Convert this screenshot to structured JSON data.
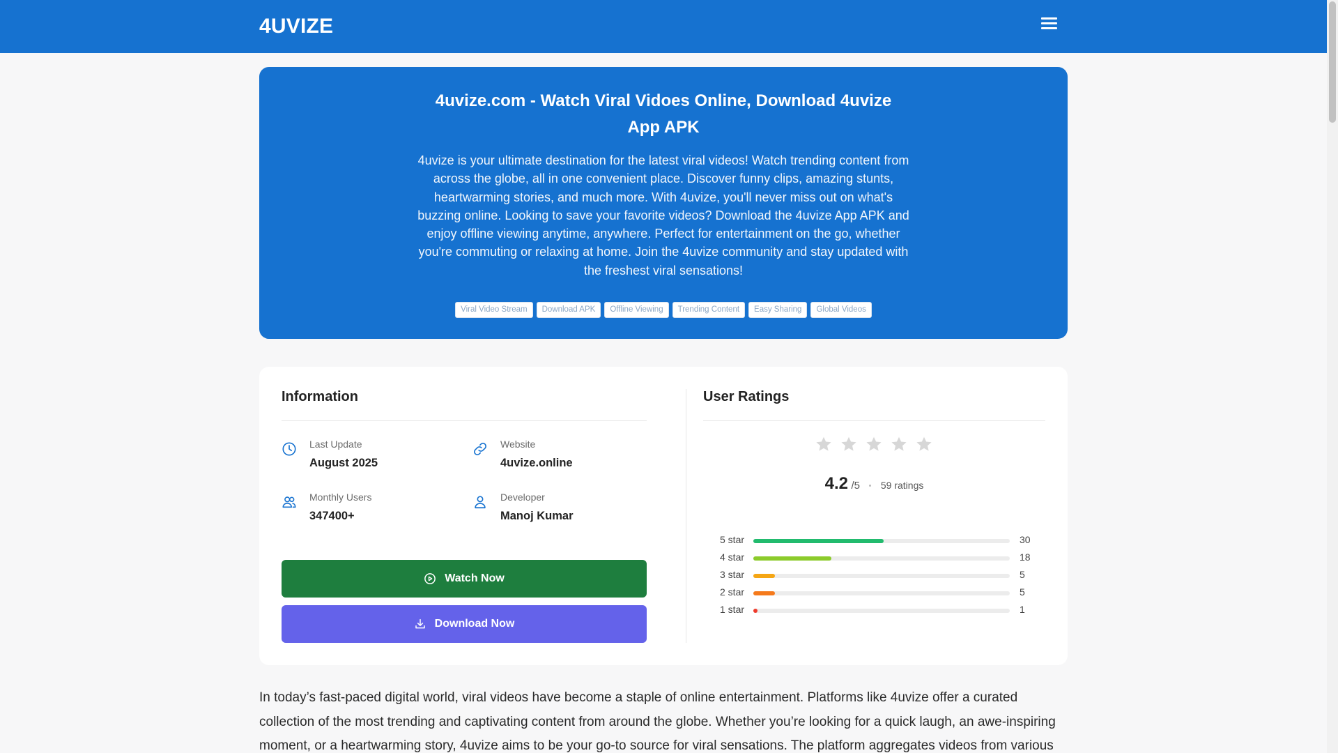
{
  "header": {
    "brand": "4UVIZE",
    "menu_icon": "hamburger-menu-icon"
  },
  "hero": {
    "title": "4uvize.com - Watch Viral Vidoes Online, Download 4uvize App APK",
    "description": "4uvize is your ultimate destination for the latest viral videos! Watch trending content from across the globe, all in one convenient place. Discover funny clips, amazing stunts, heartwarming stories, and much more. With 4uvize, you'll never miss out on what's buzzing online. Looking to save your favorite videos? Download the 4uvize App APK and enjoy offline viewing anytime, anywhere. Perfect for entertainment on the go, whether you're commuting or relaxing at home. Join the 4uvize community and stay updated with the freshest viral sensations!",
    "tags": [
      "Viral Video Stream",
      "Download APK",
      "Offline Viewing",
      "Trending Content",
      "Easy Sharing",
      "Global Videos"
    ]
  },
  "information": {
    "title": "Information",
    "items": [
      {
        "label": "Last Update",
        "value": "August 2025",
        "icon": "clock-icon"
      },
      {
        "label": "Website",
        "value": "4uvize.online",
        "icon": "link-icon"
      },
      {
        "label": "Monthly Users",
        "value": "347400+",
        "icon": "users-icon"
      },
      {
        "label": "Developer",
        "value": "Manoj Kumar",
        "icon": "user-icon"
      }
    ],
    "watch_label": "Watch Now",
    "download_label": "Download Now"
  },
  "ratings": {
    "title": "User Ratings",
    "score": "4.2",
    "out_of": "/5",
    "count_text": "59 ratings",
    "stars_filled": 0,
    "stars_total": 5,
    "breakdown": [
      {
        "label": "5 star",
        "count": "30",
        "fraction": 0.508,
        "color": "#22bb6e"
      },
      {
        "label": "4 star",
        "count": "18",
        "fraction": 0.305,
        "color": "#8ccb2b"
      },
      {
        "label": "3 star",
        "count": "5",
        "fraction": 0.085,
        "color": "#f5a614"
      },
      {
        "label": "2 star",
        "count": "5",
        "fraction": 0.085,
        "color": "#f57a1c"
      },
      {
        "label": "1 star",
        "count": "1",
        "fraction": 0.017,
        "color": "#ef3b2c"
      }
    ]
  },
  "article": {
    "text": "In today’s fast-paced digital world, viral videos have become a staple of online entertainment. Platforms like 4uvize offer a curated collection of the most trending and captivating content from around the globe. Whether you’re looking for a quick laugh, an awe-inspiring moment, or a heartwarming story, 4uvize aims to be your go-to source for viral sensations. The platform aggregates videos from various"
  },
  "colors": {
    "brand_blue": "#1672d0",
    "watch_green": "#1e7e3e",
    "download_purple": "#6462ea"
  }
}
